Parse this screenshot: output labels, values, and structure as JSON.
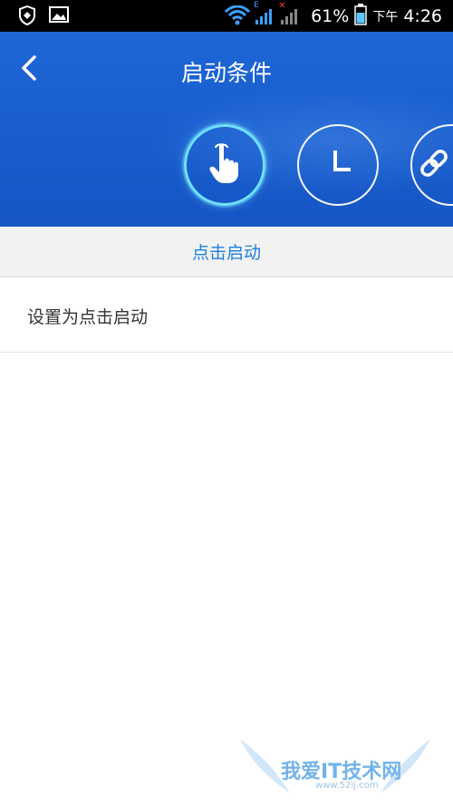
{
  "status_bar": {
    "battery_percent": "61%",
    "period": "下午",
    "time": "4:26",
    "network_type": "E",
    "icons": [
      "shield-icon",
      "image-icon",
      "wifi-icon",
      "signal-icon",
      "signal-no-service-icon",
      "battery-icon"
    ]
  },
  "header": {
    "title": "启动条件",
    "back_icon": "chevron-left-icon"
  },
  "conditions": [
    {
      "icon": "tap-hand-icon",
      "active": true
    },
    {
      "icon": "clock-icon",
      "active": false
    },
    {
      "icon": "link-icon",
      "active": false
    }
  ],
  "tab": {
    "label": "点击启动"
  },
  "list": [
    {
      "label": "设置为点击启动"
    }
  ],
  "watermark": {
    "text": "我爱IT技术网",
    "sub": "www.52ij.com"
  },
  "colors": {
    "header_blue": "#1a5fd0",
    "accent_blue": "#1a7fe0",
    "active_ring": "#6fe0ff"
  }
}
